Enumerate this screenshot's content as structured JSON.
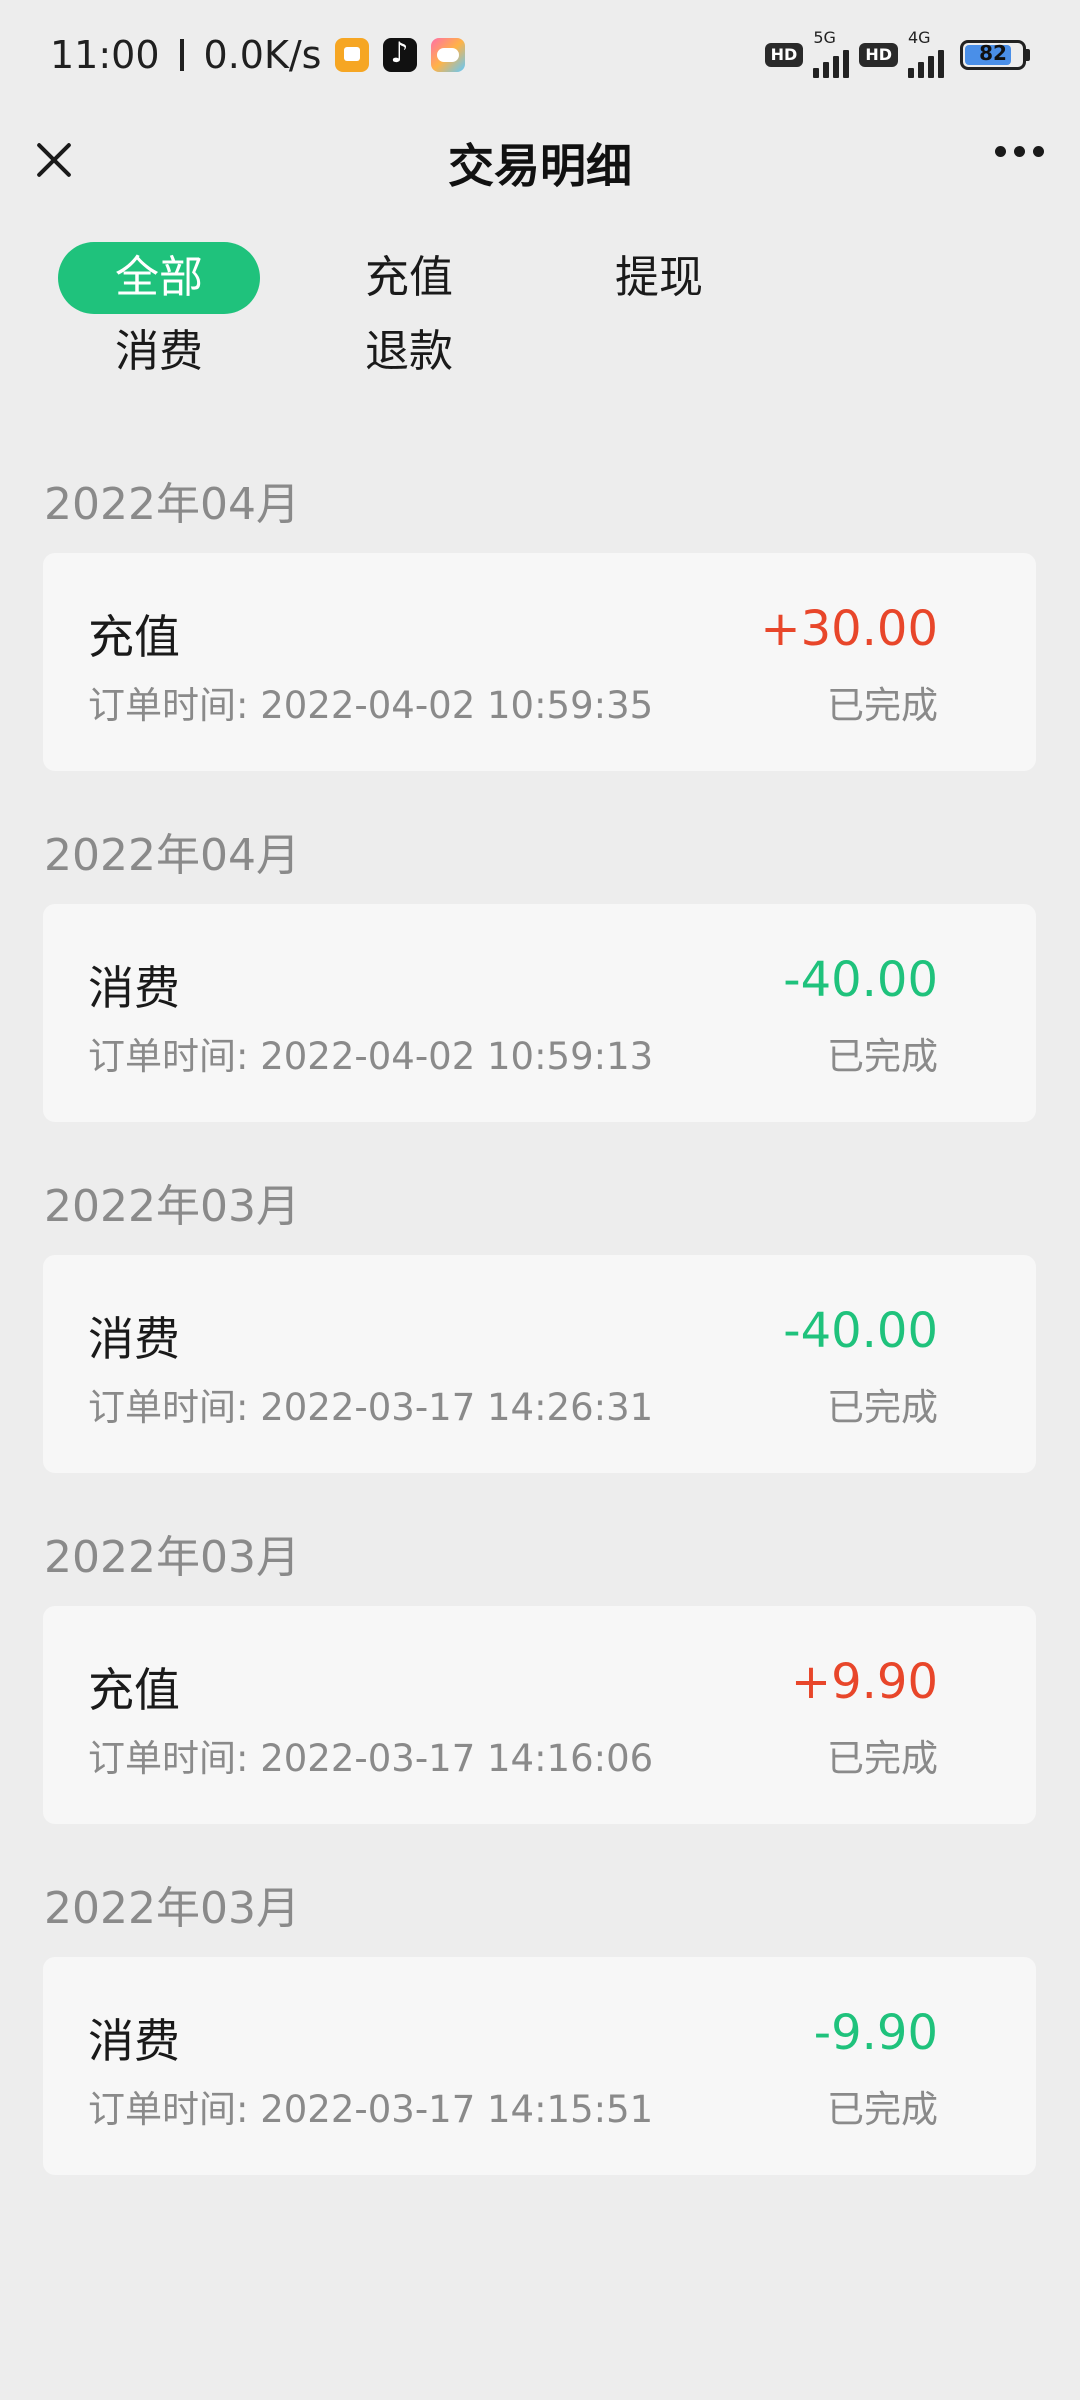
{
  "status_bar": {
    "time": "11:00",
    "speed": "0.0K/s",
    "hd1": "HD",
    "gen1": "5G",
    "hd2": "HD",
    "gen2": "4G",
    "battery": "82"
  },
  "header": {
    "title": "交易明细"
  },
  "filters": [
    {
      "label": "全部",
      "active": true
    },
    {
      "label": "充值",
      "active": false
    },
    {
      "label": "提现",
      "active": false
    },
    {
      "label": "消费",
      "active": false
    },
    {
      "label": "退款",
      "active": false
    }
  ],
  "groups": [
    {
      "month": "2022年04月",
      "type": "充值",
      "time_label": "订单时间: 2022-04-02 10:59:35",
      "amount": "+30.00",
      "status": "已完成"
    },
    {
      "month": "2022年04月",
      "type": "消费",
      "time_label": "订单时间: 2022-04-02 10:59:13",
      "amount": "-40.00",
      "status": "已完成"
    },
    {
      "month": "2022年03月",
      "type": "消费",
      "time_label": "订单时间: 2022-03-17 14:26:31",
      "amount": "-40.00",
      "status": "已完成"
    },
    {
      "month": "2022年03月",
      "type": "充值",
      "time_label": "订单时间: 2022-03-17 14:16:06",
      "amount": "+9.90",
      "status": "已完成"
    },
    {
      "month": "2022年03月",
      "type": "消费",
      "time_label": "订单时间: 2022-03-17 14:15:51",
      "amount": "-9.90",
      "status": "已完成"
    }
  ],
  "colors": {
    "accent": "#1fc27c",
    "income": "#e8462a",
    "expense": "#1fc27c"
  }
}
